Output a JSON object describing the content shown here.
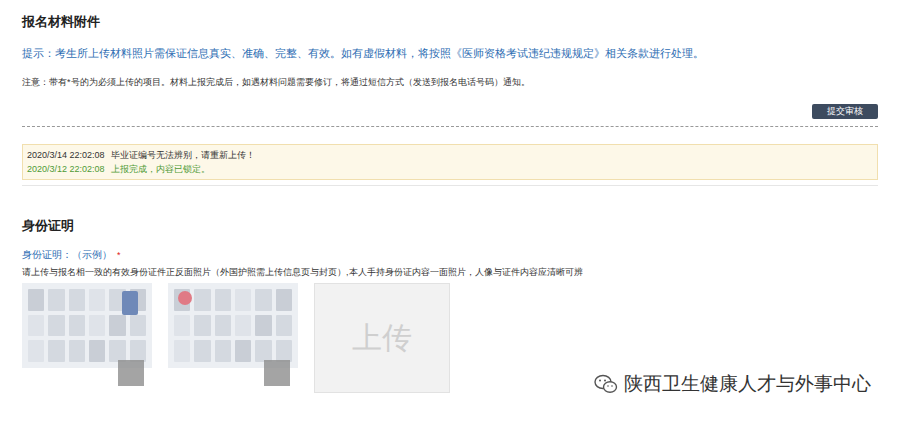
{
  "page": {
    "title": "报名材料附件",
    "tip": "提示：考生所上传材料照片需保证信息真实、准确、完整、有效。如有虚假材料，将按照《医师资格考试违纪违规规定》相关条款进行处理。",
    "note": "注意：带有*号的为必须上传的项目。材料上报完成后，如遇材料问题需要修订，将通过短信方式（发送到报名电话号码）通知。",
    "submit_button": "提交审核"
  },
  "logs": [
    {
      "time": "2020/3/14 22:02:08",
      "message": "毕业证编号无法辨别，请重新上传！",
      "kind": "error"
    },
    {
      "time": "2020/3/12 22:02:08",
      "message": "上报完成，内容已锁定。",
      "kind": "success"
    }
  ],
  "section": {
    "title": "身份证明",
    "field_label": "身份证明：",
    "example_link": "（示例）",
    "required_mark": "*",
    "instruction": "请上传与报名相一致的有效身份证件正反面照片（外国护照需上传信息页与封页）,本人手持身份证内容一面照片，人像与证件内容应清晰可辨"
  },
  "uploads": [
    {
      "kind": "image"
    },
    {
      "kind": "image"
    },
    {
      "kind": "upload",
      "label": "上传"
    }
  ],
  "watermark": "陕西卫生健康人才与外事中心"
}
